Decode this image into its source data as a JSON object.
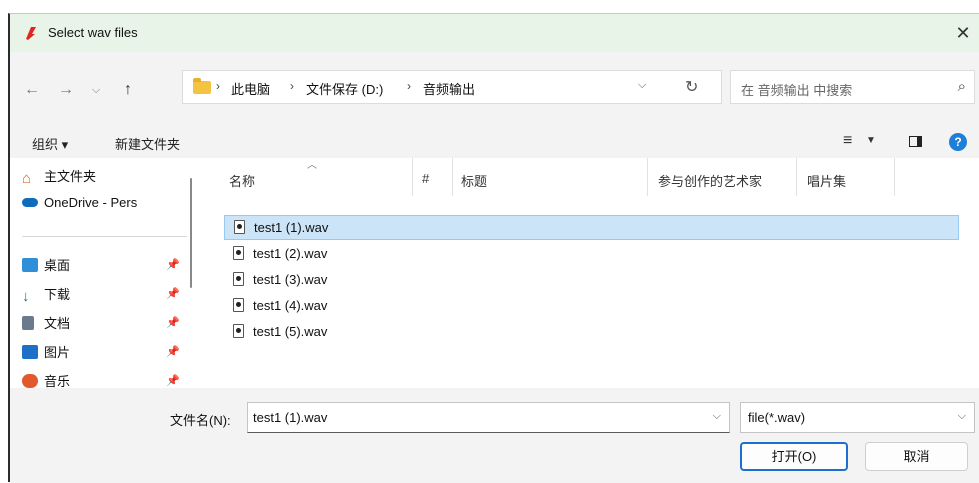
{
  "window": {
    "title": "Select wav files",
    "app_icon": "acrobat-logo-icon",
    "close_label": "✕"
  },
  "nav": {
    "back_icon": "back-arrow-icon",
    "forward_icon": "forward-arrow-icon",
    "recent_icon": "chevron-down-icon",
    "up_icon": "up-arrow-icon",
    "breadcrumb": [
      "此电脑",
      "文件保存 (D:)",
      "音频输出"
    ],
    "refresh_icon": "refresh-icon",
    "search_placeholder": "在 音频输出 中搜索"
  },
  "toolbar": {
    "organize_label": "组织 ▾",
    "new_folder_label": "新建文件夹"
  },
  "sidebar": {
    "items": [
      {
        "label": "主文件夹",
        "icon": "home-icon"
      },
      {
        "label": "OneDrive - Pers",
        "icon": "onedrive-cloud-icon"
      },
      {
        "label": "桌面",
        "icon": "desktop-icon"
      },
      {
        "label": "下载",
        "icon": "download-icon"
      },
      {
        "label": "文档",
        "icon": "document-icon"
      },
      {
        "label": "图片",
        "icon": "pictures-icon"
      },
      {
        "label": "音乐",
        "icon": "music-icon"
      }
    ]
  },
  "filelist": {
    "columns": [
      "名称",
      "#",
      "标题",
      "参与创作的艺术家",
      "唱片集"
    ],
    "files": [
      "test1 (1).wav",
      "test1 (2).wav",
      "test1 (3).wav",
      "test1 (4).wav",
      "test1 (5).wav"
    ],
    "selected_index": 0
  },
  "bottom": {
    "filename_label": "文件名(N):",
    "filename_value": "test1 (1).wav",
    "filetype_value": "file(*.wav)",
    "open_label": "打开(O)",
    "cancel_label": "取消"
  },
  "colors": {
    "accent": "#1c6fd1",
    "selection": "#cce4f7",
    "titlebar": "#e8f4e8"
  }
}
